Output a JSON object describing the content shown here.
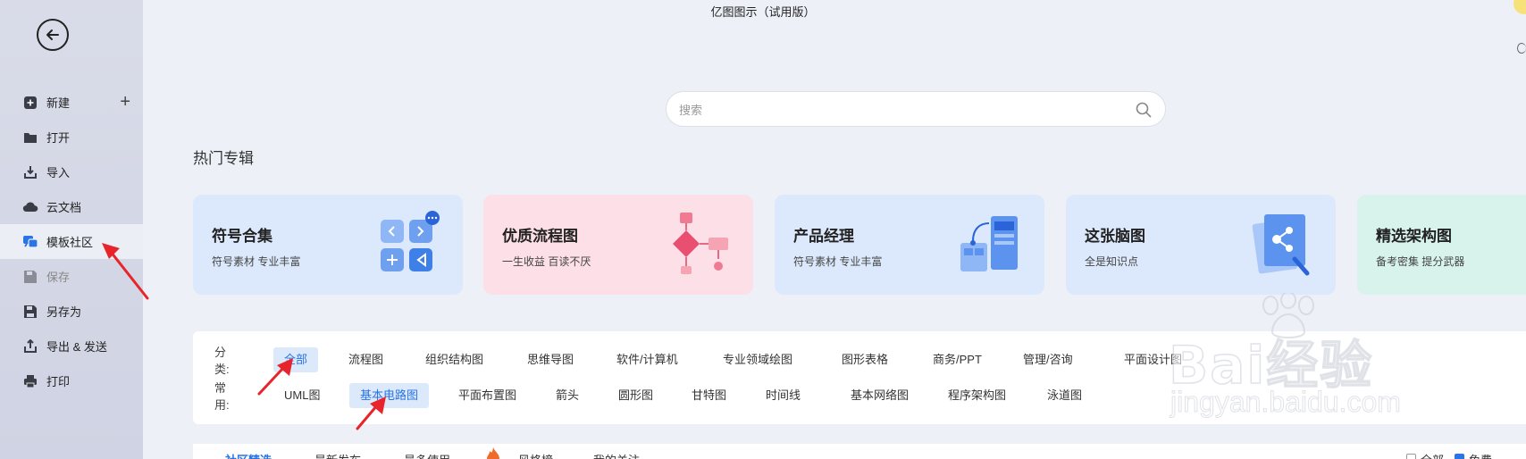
{
  "window": {
    "title": "亿图图示（试用版）"
  },
  "sidebar": {
    "items": [
      {
        "label": "新建",
        "icon": "plus-square-icon"
      },
      {
        "label": "打开",
        "icon": "folder-icon"
      },
      {
        "label": "导入",
        "icon": "import-icon"
      },
      {
        "label": "云文档",
        "icon": "cloud-icon"
      },
      {
        "label": "模板社区",
        "icon": "template-community-icon",
        "active": true
      },
      {
        "label": "保存",
        "icon": "save-icon",
        "disabled": true
      },
      {
        "label": "另存为",
        "icon": "save-as-icon"
      },
      {
        "label": "导出 & 发送",
        "icon": "export-icon"
      },
      {
        "label": "打印",
        "icon": "printer-icon"
      }
    ]
  },
  "search": {
    "placeholder": "搜索"
  },
  "hot": {
    "title": "热门专辑",
    "cards": [
      {
        "title": "符号合集",
        "subtitle": "符号素材 专业丰富",
        "bg": "#dce9fc"
      },
      {
        "title": "优质流程图",
        "subtitle": "一生收益 百读不厌",
        "bg": "#fde0e7"
      },
      {
        "title": "产品经理",
        "subtitle": "符号素材 专业丰富",
        "bg": "#dce9fc"
      },
      {
        "title": "这张脑图",
        "subtitle": "全是知识点",
        "bg": "#dce9fc"
      },
      {
        "title": "精选架构图",
        "subtitle": "备考密集 提分武器",
        "bg": "#d7f3ec"
      }
    ]
  },
  "filter": {
    "category_label": "分类:",
    "categories": [
      "全部",
      "流程图",
      "组织结构图",
      "思维导图",
      "软件/计算机",
      "专业领域绘图",
      "图形表格",
      "商务/PPT",
      "管理/咨询",
      "平面设计图"
    ],
    "common_label": "常用:",
    "common": [
      "UML图",
      "基本电路图",
      "平面布置图",
      "箭头",
      "圆形图",
      "甘特图",
      "时间线",
      "基本网络图",
      "程序架构图",
      "泳道图"
    ]
  },
  "tabs": [
    "社区精选",
    "最新发布",
    "最多使用",
    "风格榜",
    "我的关注"
  ],
  "right_options": [
    "全部",
    "免费"
  ],
  "watermark": {
    "brand": "Bai经验",
    "url": "jingyan.baidu.com"
  },
  "colors": {
    "accent": "#2a74e6",
    "annotation": "#e8242b"
  }
}
